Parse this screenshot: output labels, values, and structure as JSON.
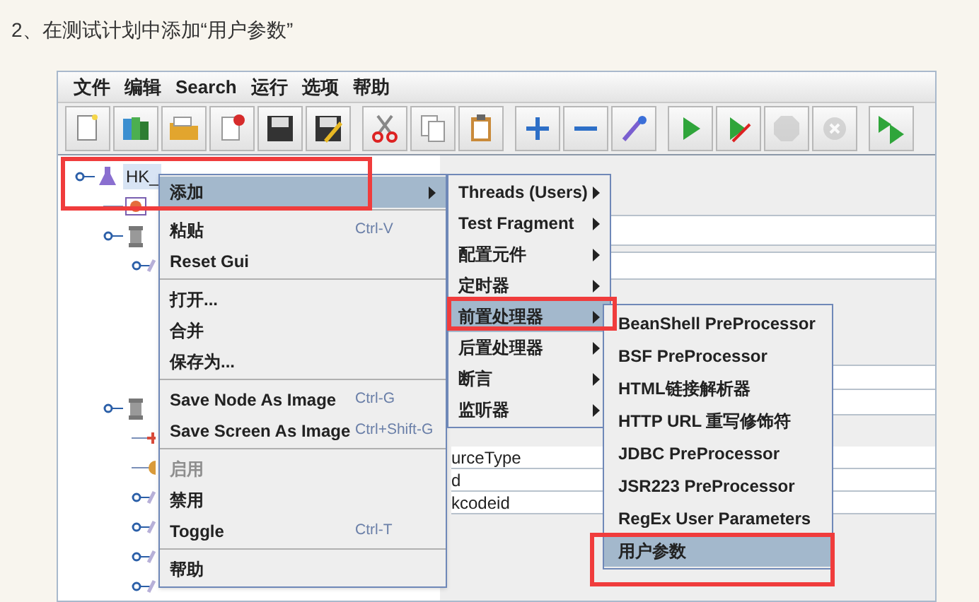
{
  "heading": "2、在测试计划中添加“用户参数”",
  "menubar": [
    {
      "label": "文件"
    },
    {
      "label": "编辑"
    },
    {
      "label": "Search"
    },
    {
      "label": "运行"
    },
    {
      "label": "选项"
    },
    {
      "label": "帮助"
    }
  ],
  "toolbar": [
    [
      {
        "kind": "new",
        "disabled": false
      },
      {
        "kind": "templates",
        "disabled": false
      },
      {
        "kind": "open",
        "disabled": false
      },
      {
        "kind": "close",
        "disabled": false
      },
      {
        "kind": "save",
        "disabled": false
      },
      {
        "kind": "save-as",
        "disabled": false
      }
    ],
    [
      {
        "kind": "cut",
        "disabled": false
      },
      {
        "kind": "copy",
        "disabled": false
      },
      {
        "kind": "paste",
        "disabled": false
      }
    ],
    [
      {
        "kind": "expand",
        "disabled": false
      },
      {
        "kind": "collapse",
        "disabled": false
      },
      {
        "kind": "toggle",
        "disabled": false
      }
    ],
    [
      {
        "kind": "start",
        "disabled": false
      },
      {
        "kind": "start-no-pauses",
        "disabled": false
      },
      {
        "kind": "stop",
        "disabled": true
      },
      {
        "kind": "shutdown",
        "disabled": true
      }
    ],
    [
      {
        "kind": "remote-start",
        "disabled": false
      }
    ]
  ],
  "tree": [
    {
      "label": "HK_",
      "kind": "test-plan",
      "selected": true,
      "children": [
        {
          "kind": "config",
          "selected": false
        },
        {
          "kind": "thread-group",
          "selected": false,
          "children": [
            {
              "kind": "controller",
              "selected": false
            }
          ]
        },
        {
          "kind": "thread-group",
          "selected": false,
          "children": [
            {
              "kind": "defaults",
              "selected": false
            },
            {
              "kind": "cookie",
              "selected": false
            },
            {
              "kind": "controller",
              "selected": false
            },
            {
              "kind": "controller",
              "selected": false
            },
            {
              "kind": "controller",
              "selected": false
            },
            {
              "kind": "controller",
              "selected": false
            }
          ]
        }
      ]
    }
  ],
  "parameter_rows": [
    {
      "name": "urceType"
    },
    {
      "name": "d"
    },
    {
      "name": "kcodeid"
    }
  ],
  "context_menu": {
    "groups": [
      [
        {
          "label": "添加",
          "submenu": true,
          "selected": true,
          "disabled": false
        }
      ],
      [
        {
          "label": "粘贴",
          "shortcut": "Ctrl-V",
          "submenu": false,
          "selected": false,
          "disabled": false
        },
        {
          "label": "Reset Gui",
          "submenu": false,
          "selected": false,
          "disabled": false
        }
      ],
      [
        {
          "label": "打开...",
          "submenu": false,
          "selected": false,
          "disabled": false
        },
        {
          "label": "合并",
          "submenu": false,
          "selected": false,
          "disabled": false
        },
        {
          "label": "保存为...",
          "submenu": false,
          "selected": false,
          "disabled": false
        }
      ],
      [
        {
          "label": "Save Node As Image",
          "shortcut": "Ctrl-G",
          "submenu": false,
          "selected": false,
          "disabled": false
        },
        {
          "label": "Save Screen As Image",
          "shortcut": "Ctrl+Shift-G",
          "submenu": false,
          "selected": false,
          "disabled": false
        }
      ],
      [
        {
          "label": "启用",
          "submenu": false,
          "selected": false,
          "disabled": true
        },
        {
          "label": "禁用",
          "submenu": false,
          "selected": false,
          "disabled": false
        },
        {
          "label": "Toggle",
          "shortcut": "Ctrl-T",
          "submenu": false,
          "selected": false,
          "disabled": false
        }
      ],
      [
        {
          "label": "帮助",
          "submenu": false,
          "selected": false,
          "disabled": false
        }
      ]
    ]
  },
  "add_submenu": [
    {
      "label": "Threads (Users)",
      "submenu": true,
      "selected": false
    },
    {
      "label": "Test Fragment",
      "submenu": true,
      "selected": false
    },
    {
      "label": "配置元件",
      "submenu": true,
      "selected": false
    },
    {
      "label": "定时器",
      "submenu": true,
      "selected": false
    },
    {
      "label": "前置处理器",
      "submenu": true,
      "selected": true
    },
    {
      "label": "后置处理器",
      "submenu": true,
      "selected": false
    },
    {
      "label": "断言",
      "submenu": true,
      "selected": false
    },
    {
      "label": "监听器",
      "submenu": true,
      "selected": false
    }
  ],
  "preprocessor_submenu": [
    {
      "label": "BeanShell PreProcessor",
      "selected": false
    },
    {
      "label": "BSF PreProcessor",
      "selected": false
    },
    {
      "label": "HTML链接解析器",
      "selected": false
    },
    {
      "label": "HTTP URL 重写修饰符",
      "selected": false
    },
    {
      "label": "JDBC PreProcessor",
      "selected": false
    },
    {
      "label": "JSR223 PreProcessor",
      "selected": false
    },
    {
      "label": "RegEx User Parameters",
      "selected": false
    },
    {
      "label": "用户参数",
      "selected": true
    }
  ]
}
